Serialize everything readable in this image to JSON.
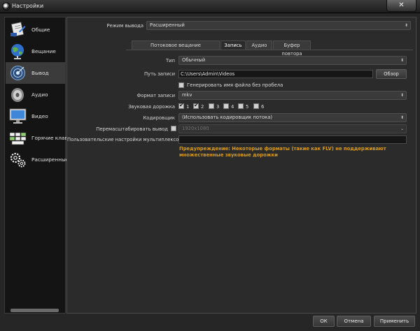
{
  "window": {
    "title": "Настройки",
    "close_glyph": "✕"
  },
  "sidebar": {
    "items": [
      {
        "label": "Общие",
        "icon": "settings-doc-icon"
      },
      {
        "label": "Вещание",
        "icon": "broadcast-globe-icon"
      },
      {
        "label": "Вывод",
        "icon": "output-satellite-icon",
        "active": true
      },
      {
        "label": "Аудио",
        "icon": "speaker-icon"
      },
      {
        "label": "Видео",
        "icon": "monitor-icon"
      },
      {
        "label": "Горячие клави",
        "icon": "keyboard-icon"
      },
      {
        "label": "Расширенные",
        "icon": "gears-icon"
      }
    ]
  },
  "output_mode": {
    "label": "Режим вывода",
    "value": "Расширенный"
  },
  "tabs": [
    {
      "label": "Потоковое вещание"
    },
    {
      "label": "Запись",
      "active": true
    },
    {
      "label": "Аудио"
    },
    {
      "label": "Буфер повтора"
    }
  ],
  "recording": {
    "type_label": "Тип",
    "type_value": "Обычный",
    "path_label": "Путь записи",
    "path_value": "C:\\Users\\Admin\\Videos",
    "browse_label": "Обзор",
    "no_space_label": "Генерировать имя файла без пробела",
    "no_space_checked": false,
    "format_label": "Формат записи",
    "format_value": "mkv",
    "tracks_label": "Звуковая дорожка",
    "tracks": [
      {
        "label": "1",
        "checked": true
      },
      {
        "label": "2",
        "checked": true
      },
      {
        "label": "3",
        "checked": false
      },
      {
        "label": "4",
        "checked": false
      },
      {
        "label": "5",
        "checked": false
      },
      {
        "label": "6",
        "checked": false
      }
    ],
    "encoder_label": "Кодировщик",
    "encoder_value": "(Использовать кодировщик потока)",
    "rescale_label": "Перемасштабировать вывод",
    "rescale_checked": false,
    "rescale_value": "1920x1080",
    "muxer_label": "Пользовательские настройки мультиплексора",
    "muxer_value": "",
    "warning": "Предупреждение: Некоторые форматы (такие как FLV) не поддерживают множественные звуковые дорожки"
  },
  "footer": {
    "ok_label": "ОК",
    "cancel_label": "Отмена",
    "apply_label": "Применить"
  },
  "colors": {
    "warning": "#d89a1a",
    "background": "#262626"
  }
}
